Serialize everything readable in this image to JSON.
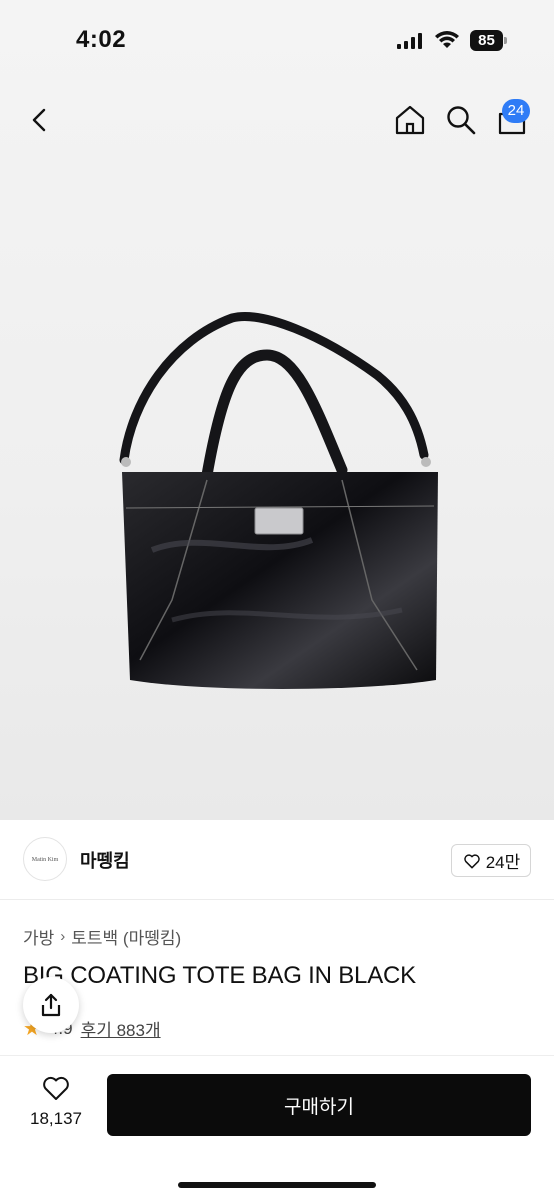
{
  "status": {
    "time": "4:02",
    "battery": "85"
  },
  "nav": {
    "cart_count": "24"
  },
  "shop": {
    "logo_text": "Matin Kim",
    "name": "마뗑킴",
    "likes": "24만"
  },
  "breadcrumb": {
    "category": "가방",
    "subcategory": "토트백 (마뗑킴)"
  },
  "product": {
    "title": "BIG COATING TOTE BAG IN BLACK",
    "rating": "4.9",
    "reviews": "후기 883개"
  },
  "bottom": {
    "wish_count": "18,137",
    "buy_label": "구매하기"
  },
  "icons": [
    "back-icon",
    "home-icon",
    "search-icon",
    "cart-icon",
    "heart-icon",
    "share-icon",
    "star-icon"
  ]
}
